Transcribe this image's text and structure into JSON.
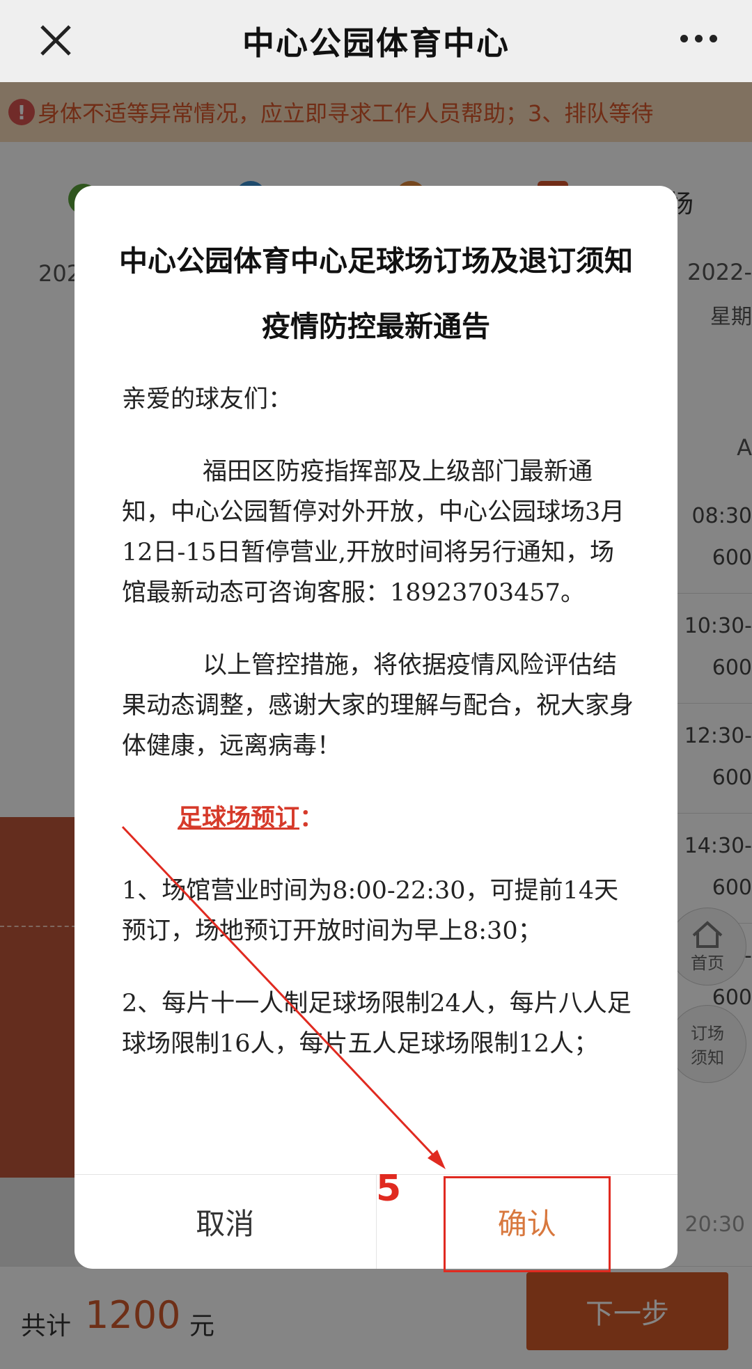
{
  "navbar": {
    "title": "中心公园体育中心",
    "close_icon": "close-icon",
    "more_icon": "more-icon"
  },
  "notice": {
    "icon_text": "!",
    "text": "身体不适等异常情况，应立即寻求工作人员帮助；3、排队等待"
  },
  "background": {
    "tab_label": "场",
    "date_left": "202",
    "date_right": "2022-",
    "week_right": "星期",
    "column_head": "A",
    "slots": [
      {
        "time": "08:30",
        "price": "600"
      },
      {
        "time": "10:30-",
        "price": "600"
      },
      {
        "time": "12:30-",
        "price": "600"
      },
      {
        "time": "14:30-",
        "price": "600"
      },
      {
        "time": "0-",
        "price": "600"
      }
    ],
    "home_label": "首页",
    "notice_btn_label_1": "订场",
    "notice_btn_label_2": "须知",
    "time_bottom": "20:30"
  },
  "bottombar": {
    "total_label": "共计",
    "total_value": "1200",
    "total_unit": "元",
    "next_label": "下一步"
  },
  "modal": {
    "title": "中心公园体育中心足球场订场及退订须知",
    "subtitle": "疫情防控最新通告",
    "greeting": "亲爱的球友们：",
    "para1": "福田区防疫指挥部及上级部门最新通知，中心公园暂停对外开放，中心公园球场3月12日-15日暂停营业,开放时间将另行通知，场馆最新动态可咨询客服：18923703457。",
    "para2": "以上管控措施，将依据疫情风险评估结果动态调整，感谢大家的理解与配合，祝大家身体健康，远离病毒！",
    "section_head": "足球场预订",
    "section_colon": "：",
    "rule1": "1、场馆营业时间为8:00-22:30，可提前14天预订，场地预订开放时间为早上8:30；",
    "rule2": "2、每片十一人制足球场限制24人，每片八人足球场限制16人，每片五人足球场限制12人；",
    "cancel_label": "取消",
    "confirm_label": "确认"
  },
  "annotation": {
    "step_number": "5",
    "color": "#e02a20"
  }
}
